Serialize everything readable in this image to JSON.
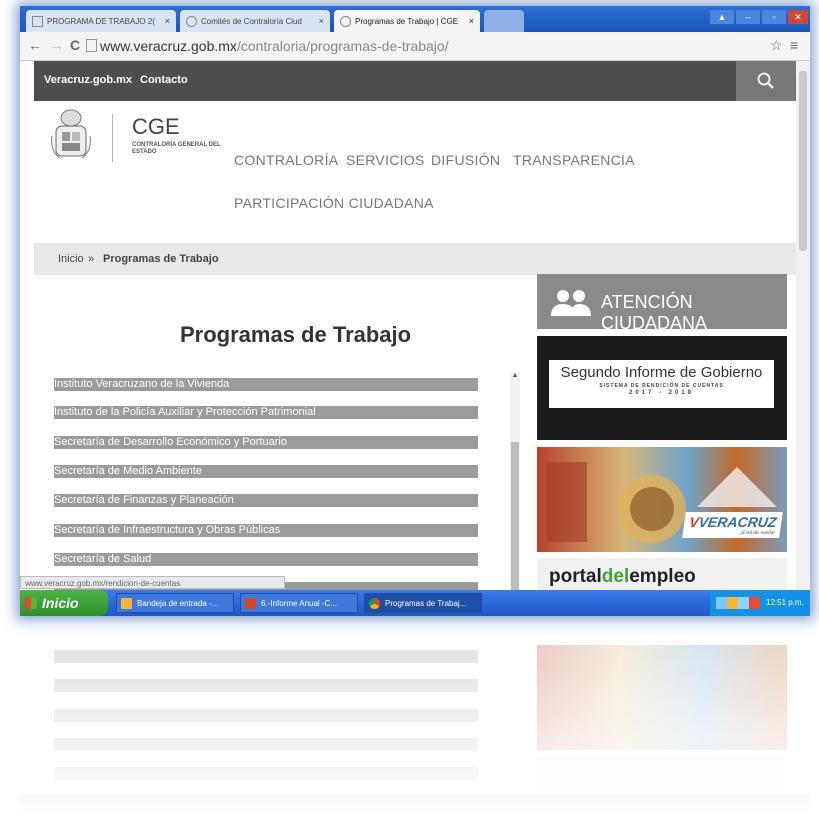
{
  "browser": {
    "tabs": [
      {
        "label": "PROGRAMA DE TRABAJO 2(",
        "close": "×"
      },
      {
        "label": "Comités de Contraloría Ciud",
        "close": "×"
      },
      {
        "label": "Programas de Trabajo | CGE",
        "close": "×"
      }
    ],
    "url_domain": "www.veracruz.gob.mx",
    "url_path": "/contraloria/programas-de-trabajo/",
    "back": "←",
    "forward": "→",
    "reload": "C",
    "star": "☆",
    "menu": "≡"
  },
  "site": {
    "top_links": [
      "Veracruz.gob.mx",
      "Contacto"
    ],
    "search_icon": "search-icon",
    "org_short": "CGE",
    "org_full": "CONTRALORÍA GENERAL DEL ESTADO",
    "nav": [
      "CONTRALORÍA",
      "SERVICIOS",
      "DIFUSIÓN",
      "TRANSPARENCIA",
      "PARTICIPACIÓN CIUDADANA"
    ],
    "breadcrumb": {
      "home": "Inicio",
      "sep": "»",
      "current": "Programas de Trabajo"
    },
    "page_title": "Programas de Trabajo",
    "programs": [
      "Instituto Veracruzano de la Vivienda",
      "Instituto de la Policía Auxiliar y Protección Patrimonial",
      "Secretaría de Desarrollo Económico y Portuario",
      "Secretaría de Medio Ambiente",
      "Secretaría de Finanzas y Planeación",
      "Secretaría de Infraestructura y Obras Públicas",
      "Secretaría de Salud"
    ],
    "sidebar": {
      "atencion": "ATENCIÓN CIUDADANA",
      "informe_title": "Segundo Informe de Gobierno",
      "informe_sub": "SISTEMA DE RENDICIÓN DE CUENTAS",
      "informe_years": "2017 - 2018",
      "veracruz_logo": "VERACRUZ",
      "veracruz_tag": "¡Está de vuelta!",
      "portal_a": "portal",
      "portal_b": "del",
      "portal_c": "empleo"
    },
    "status_url": "www.veracruz.gob.mx/rendicion-de-cuentas"
  },
  "taskbar": {
    "start": "Inicio",
    "tasks": [
      "Bandeja de entrada -...",
      "6.-Informe Anual -C...",
      "Programas de Trabaj..."
    ],
    "clock": "12:51 p.m."
  },
  "colors": {
    "accent": "#2157c4",
    "start_green": "#2e8f2a",
    "list_gray": "#9b9b9b"
  }
}
